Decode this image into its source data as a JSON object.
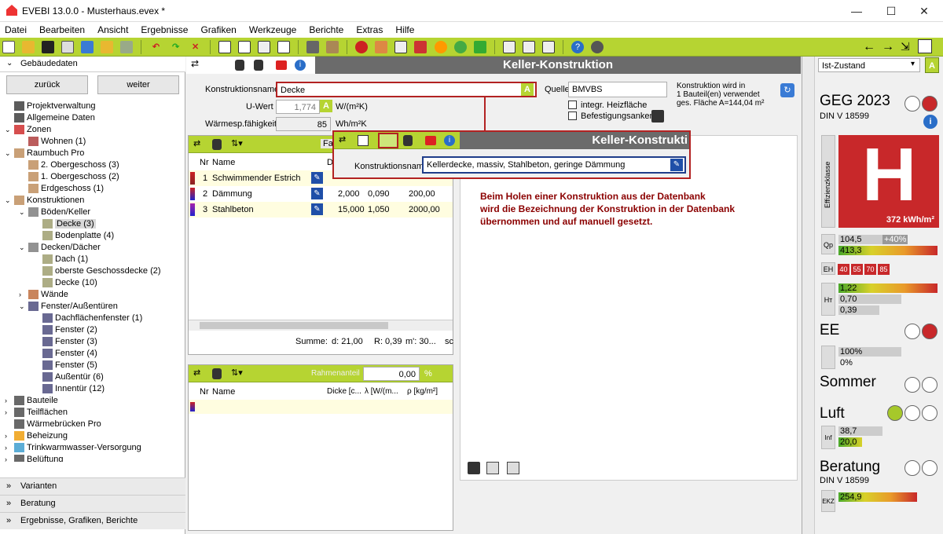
{
  "app": {
    "title": "EVEBI 13.0.0 - Musterhaus.evex *"
  },
  "menu": [
    "Datei",
    "Bearbeiten",
    "Ansicht",
    "Ergebnisse",
    "Grafiken",
    "Werkzeuge",
    "Berichte",
    "Extras",
    "Hilfe"
  ],
  "sidebar": {
    "header": "Gebäudedaten",
    "back": "zurück",
    "next": "weiter",
    "tree": [
      "Projektverwaltung",
      "Allgemeine Daten",
      "Zonen",
      "Wohnen (1)",
      "Raumbuch Pro",
      "2. Obergeschoss (3)",
      "1. Obergeschoss (2)",
      "Erdgeschoss (1)",
      "Konstruktionen",
      "Böden/Keller",
      "Decke (3)",
      "Bodenplatte (4)",
      "Decken/Dächer",
      "Dach (1)",
      "oberste Geschossdecke (2)",
      "Decke (10)",
      "Wände",
      "Fenster/Außentüren",
      "Dachflächenfenster (1)",
      "Fenster (2)",
      "Fenster (3)",
      "Fenster (4)",
      "Fenster (5)",
      "Außentür (6)",
      "Innentür (12)",
      "Bauteile",
      "Teilflächen",
      "Wärmebrücken Pro",
      "Beheizung",
      "Trinkwarmwasser-Versorgung",
      "Belüftung"
    ],
    "sections": [
      "Varianten",
      "Beratung",
      "Ergebnisse, Grafiken, Berichte"
    ]
  },
  "main": {
    "title": "Keller-Konstruktion",
    "name_label": "Konstruktionsname",
    "name_value": "Decke",
    "uwert_label": "U-Wert",
    "uwert_value": "1,774",
    "uwert_unit": "W/(m²K)",
    "waerme_label": "Wärmesp.fähigkeit",
    "waerme_value": "85",
    "waerme_unit": "Wh/m²K",
    "quelle_label": "Quelle",
    "quelle_value": "BMVBS",
    "info": "Konstruktion wird in\n1 Bauteil(en) verwendet\nges. Fläche A=144,04 m²",
    "cb1": "integr. Heizfläche",
    "cb2": "Befestigungsanker",
    "badge": "A",
    "table_head": {
      "nr": "Nr",
      "name": "Name",
      "d": "D",
      "fa": "Fa"
    },
    "layers": [
      {
        "nr": "1",
        "name": "Schwimmender Estrich",
        "d": "",
        "l": "",
        "r": ""
      },
      {
        "nr": "2",
        "name": "Dämmung",
        "d": "2,000",
        "l": "0,090",
        "r": "200,00"
      },
      {
        "nr": "3",
        "name": "Stahlbeton",
        "d": "15,000",
        "l": "1,050",
        "r": "2000,00"
      }
    ],
    "summe": {
      "label": "Summe:",
      "d": "d: 21,00",
      "r": "R: 0,39",
      "m": "m': 30...",
      "s": "sc"
    },
    "frame_label": "Rahmenanteil",
    "frame_value": "0,00",
    "frame_unit": "%",
    "table2_head": [
      "Nr",
      "Name",
      "Dicke [c...",
      "λ [W/(m...",
      "ρ [kg/m²]"
    ]
  },
  "popup": {
    "title": "Keller-Konstrukti",
    "name_label": "Konstruktionsname",
    "name_value": "Kellerdecke, massiv, Stahlbeton, geringe Dämmung"
  },
  "note": "Beim Holen einer Konstruktion aus der Datenbank\nwird die Bezeichnung der Konstruktion in der Datenbank\nübernommen und auf manuell gesetzt.",
  "right": {
    "zustand": "Ist-Zustand",
    "zustand_badge": "A",
    "geg": "GEG 2023",
    "din": "DIN V 18599",
    "effclass_label": "Effizienzklasse",
    "effclass": "H",
    "kwh": "372 kWh/m²",
    "qp_label": "Qp",
    "qp1": "104,5",
    "qp_pct": "+40%",
    "qp2": "413,3",
    "eh_label": "EH",
    "eh": [
      "40",
      "55",
      "70",
      "85"
    ],
    "ht_label": "Hт",
    "ht1": "1,22",
    "ht2": "0,70",
    "ht3": "0,39",
    "ee": "EE",
    "ee1": "100%",
    "ee2": "0%",
    "sommer": "Sommer",
    "luft": "Luft",
    "luft_label": "Inf min",
    "luft1": "38,7",
    "luft2": "20,0",
    "beratung": "Beratung",
    "din2": "DIN V 18599",
    "ekz_label": "EKZ",
    "ekz": "254,9"
  },
  "colors": {
    "green": "#b6d432",
    "darkred": "#b22222",
    "title_bg": "#6b6b6b",
    "note": "#8b0000"
  }
}
